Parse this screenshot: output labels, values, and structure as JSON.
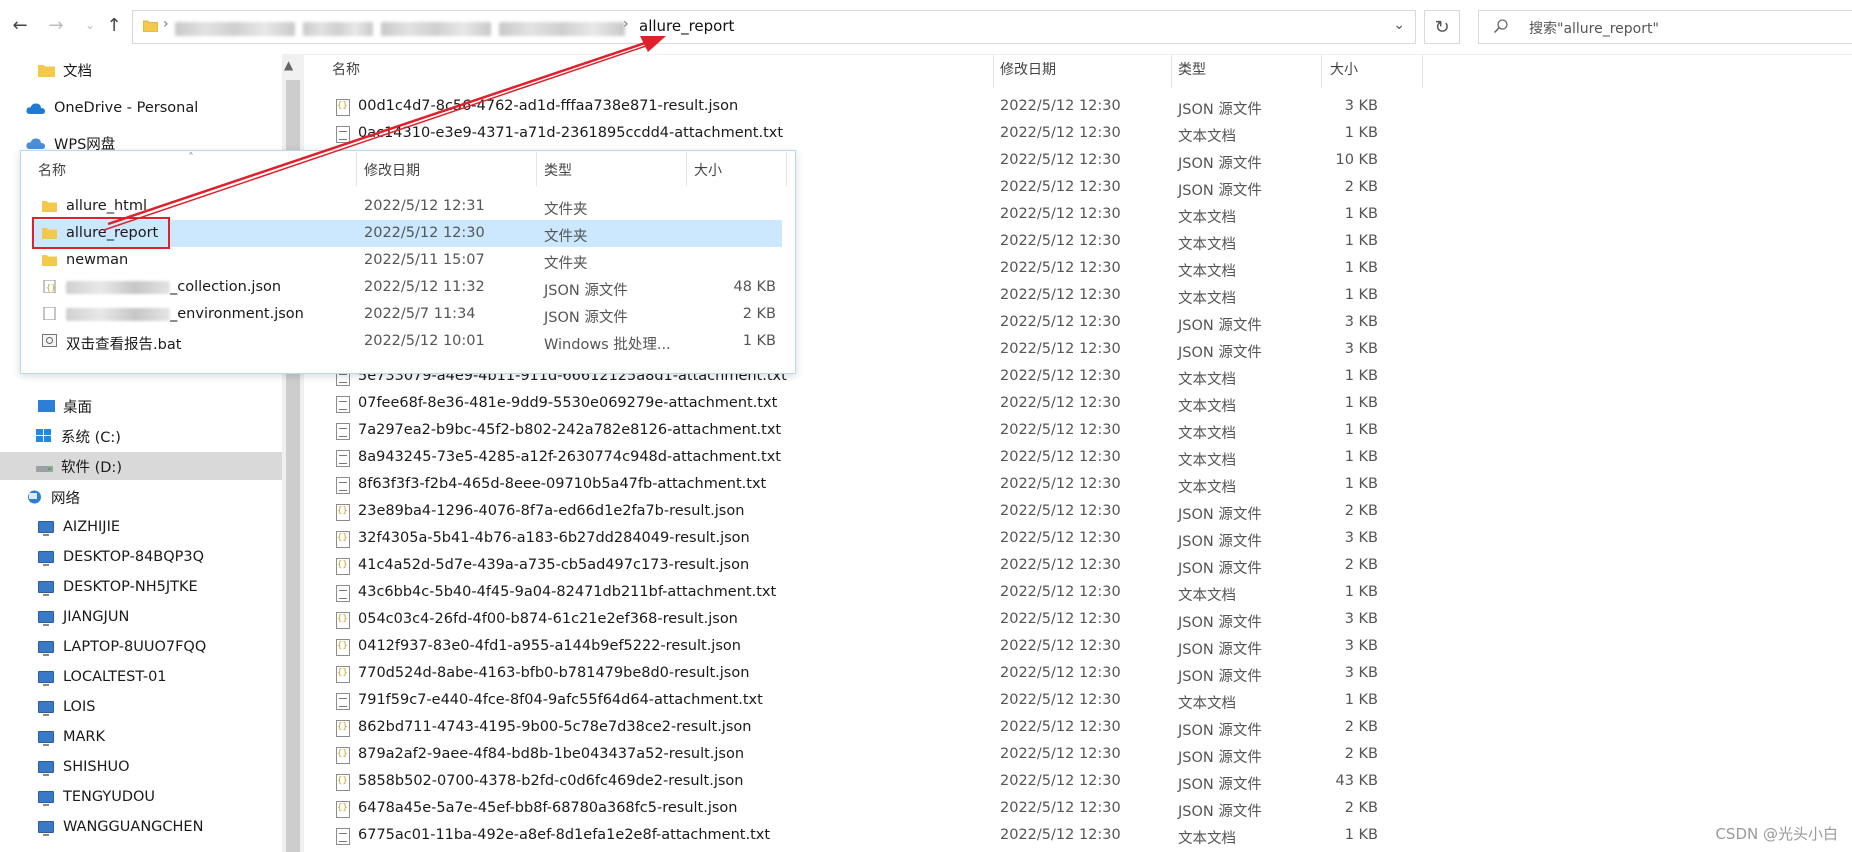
{
  "toolbar": {
    "back_icon": "back-arrow-icon",
    "forward_icon": "forward-arrow-icon",
    "up_icon": "up-arrow-icon"
  },
  "address_bar": {
    "current_folder": "allure_report",
    "refresh_icon": "refresh-icon"
  },
  "search": {
    "placeholder": "搜索\"allure_report\""
  },
  "nav": {
    "items": [
      {
        "label": "文档",
        "icon": "folder-icon"
      },
      {
        "label": "OneDrive - Personal",
        "icon": "cloud-icon"
      },
      {
        "label": "WPS网盘",
        "icon": "cloud-icon"
      },
      {
        "label": "桌面",
        "icon": "desktop-icon"
      },
      {
        "label": "系统 (C:)",
        "icon": "drive-icon"
      },
      {
        "label": "软件 (D:)",
        "icon": "drive-icon",
        "selected": true
      },
      {
        "label": "网络",
        "icon": "network-icon"
      },
      {
        "label": "AIZHIJIE",
        "icon": "computer-icon"
      },
      {
        "label": "DESKTOP-84BQP3Q",
        "icon": "computer-icon"
      },
      {
        "label": "DESKTOP-NH5JTKE",
        "icon": "computer-icon"
      },
      {
        "label": "JIANGJUN",
        "icon": "computer-icon"
      },
      {
        "label": "LAPTOP-8UUO7FQQ",
        "icon": "computer-icon"
      },
      {
        "label": "LOCALTEST-01",
        "icon": "computer-icon"
      },
      {
        "label": "LOIS",
        "icon": "computer-icon"
      },
      {
        "label": "MARK",
        "icon": "computer-icon"
      },
      {
        "label": "SHISHUO",
        "icon": "computer-icon"
      },
      {
        "label": "TENGYUDOU",
        "icon": "computer-icon"
      },
      {
        "label": "WANGGUANGCHEN",
        "icon": "computer-icon"
      }
    ]
  },
  "columns": {
    "name": "名称",
    "date": "修改日期",
    "type": "类型",
    "size": "大小"
  },
  "files": [
    {
      "name": "00d1c4d7-8c56-4762-ad1d-fffaa738e871-result.json",
      "date": "2022/5/12 12:30",
      "type": "JSON 源文件",
      "size": "3 KB",
      "kind": "json"
    },
    {
      "name": "0ac14310-e3e9-4371-a71d-2361895ccdd4-attachment.txt",
      "date": "2022/5/12 12:30",
      "type": "文本文档",
      "size": "1 KB",
      "kind": "txt"
    },
    {
      "name": "",
      "date": "2022/5/12 12:30",
      "type": "JSON 源文件",
      "size": "10 KB",
      "kind": "json"
    },
    {
      "name": "",
      "date": "2022/5/12 12:30",
      "type": "JSON 源文件",
      "size": "2 KB",
      "kind": "json"
    },
    {
      "name": "",
      "date": "2022/5/12 12:30",
      "type": "文本文档",
      "size": "1 KB",
      "kind": "txt"
    },
    {
      "name": "",
      "date": "2022/5/12 12:30",
      "type": "文本文档",
      "size": "1 KB",
      "kind": "txt"
    },
    {
      "name": "",
      "date": "2022/5/12 12:30",
      "type": "文本文档",
      "size": "1 KB",
      "kind": "txt"
    },
    {
      "name": "",
      "date": "2022/5/12 12:30",
      "type": "文本文档",
      "size": "1 KB",
      "kind": "txt"
    },
    {
      "name": "",
      "date": "2022/5/12 12:30",
      "type": "JSON 源文件",
      "size": "3 KB",
      "kind": "json"
    },
    {
      "name": "",
      "date": "2022/5/12 12:30",
      "type": "JSON 源文件",
      "size": "3 KB",
      "kind": "json"
    },
    {
      "name": "5e733079-a4e9-4b11-911d-66612125a8d1-attachment.txt",
      "date": "2022/5/12 12:30",
      "type": "文本文档",
      "size": "1 KB",
      "kind": "txt"
    },
    {
      "name": "07fee68f-8e36-481e-9dd9-5530e069279e-attachment.txt",
      "date": "2022/5/12 12:30",
      "type": "文本文档",
      "size": "1 KB",
      "kind": "txt"
    },
    {
      "name": "7a297ea2-b9bc-45f2-b802-242a782e8126-attachment.txt",
      "date": "2022/5/12 12:30",
      "type": "文本文档",
      "size": "1 KB",
      "kind": "txt"
    },
    {
      "name": "8a943245-73e5-4285-a12f-2630774c948d-attachment.txt",
      "date": "2022/5/12 12:30",
      "type": "文本文档",
      "size": "1 KB",
      "kind": "txt"
    },
    {
      "name": "8f63f3f3-f2b4-465d-8eee-09710b5a47fb-attachment.txt",
      "date": "2022/5/12 12:30",
      "type": "文本文档",
      "size": "1 KB",
      "kind": "txt"
    },
    {
      "name": "23e89ba4-1296-4076-8f7a-ed66d1e2fa7b-result.json",
      "date": "2022/5/12 12:30",
      "type": "JSON 源文件",
      "size": "2 KB",
      "kind": "json"
    },
    {
      "name": "32f4305a-5b41-4b76-a183-6b27dd284049-result.json",
      "date": "2022/5/12 12:30",
      "type": "JSON 源文件",
      "size": "3 KB",
      "kind": "json"
    },
    {
      "name": "41c4a52d-5d7e-439a-a735-cb5ad497c173-result.json",
      "date": "2022/5/12 12:30",
      "type": "JSON 源文件",
      "size": "2 KB",
      "kind": "json"
    },
    {
      "name": "43c6bb4c-5b40-4f45-9a04-82471db211bf-attachment.txt",
      "date": "2022/5/12 12:30",
      "type": "文本文档",
      "size": "1 KB",
      "kind": "txt"
    },
    {
      "name": "054c03c4-26fd-4f00-b874-61c21e2ef368-result.json",
      "date": "2022/5/12 12:30",
      "type": "JSON 源文件",
      "size": "3 KB",
      "kind": "json"
    },
    {
      "name": "0412f937-83e0-4fd1-a955-a144b9ef5222-result.json",
      "date": "2022/5/12 12:30",
      "type": "JSON 源文件",
      "size": "3 KB",
      "kind": "json"
    },
    {
      "name": "770d524d-8abe-4163-bfb0-b781479be8d0-result.json",
      "date": "2022/5/12 12:30",
      "type": "JSON 源文件",
      "size": "3 KB",
      "kind": "json"
    },
    {
      "name": "791f59c7-e440-4fce-8f04-9afc55f64d64-attachment.txt",
      "date": "2022/5/12 12:30",
      "type": "文本文档",
      "size": "1 KB",
      "kind": "txt"
    },
    {
      "name": "862bd711-4743-4195-9b00-5c78e7d38ce2-result.json",
      "date": "2022/5/12 12:30",
      "type": "JSON 源文件",
      "size": "2 KB",
      "kind": "json"
    },
    {
      "name": "879a2af2-9aee-4f84-bd8b-1be043437a52-result.json",
      "date": "2022/5/12 12:30",
      "type": "JSON 源文件",
      "size": "2 KB",
      "kind": "json"
    },
    {
      "name": "5858b502-0700-4378-b2fd-c0d6fc469de2-result.json",
      "date": "2022/5/12 12:30",
      "type": "JSON 源文件",
      "size": "43 KB",
      "kind": "json"
    },
    {
      "name": "6478a45e-5a7e-45ef-bb8f-68780a368fc5-result.json",
      "date": "2022/5/12 12:30",
      "type": "JSON 源文件",
      "size": "2 KB",
      "kind": "json"
    },
    {
      "name": "6775ac01-11ba-492e-a8ef-8d1efa1e2e8f-attachment.txt",
      "date": "2022/5/12 12:30",
      "type": "文本文档",
      "size": "1 KB",
      "kind": "txt"
    }
  ],
  "popup": {
    "columns": {
      "name": "名称",
      "date": "修改日期",
      "type": "类型",
      "size": "大小"
    },
    "rows": [
      {
        "name": "allure_html",
        "date": "2022/5/12 12:31",
        "type": "文件夹",
        "size": "",
        "kind": "folder"
      },
      {
        "name": "allure_report",
        "date": "2022/5/12 12:30",
        "type": "文件夹",
        "size": "",
        "kind": "folder",
        "selected": true
      },
      {
        "name": "newman",
        "date": "2022/5/11 15:07",
        "type": "文件夹",
        "size": "",
        "kind": "folder"
      },
      {
        "name": "_collection.json",
        "date": "2022/5/12 11:32",
        "type": "JSON 源文件",
        "size": "48 KB",
        "kind": "json"
      },
      {
        "name": "_environment.json",
        "date": "2022/5/7 11:34",
        "type": "JSON 源文件",
        "size": "2 KB",
        "kind": "json"
      },
      {
        "name": "双击查看报告.bat",
        "date": "2022/5/12 10:01",
        "type": "Windows 批处理...",
        "size": "1 KB",
        "kind": "bat"
      }
    ]
  },
  "annotation": {
    "color": "#e0202a"
  },
  "watermark": "CSDN @光头小白"
}
